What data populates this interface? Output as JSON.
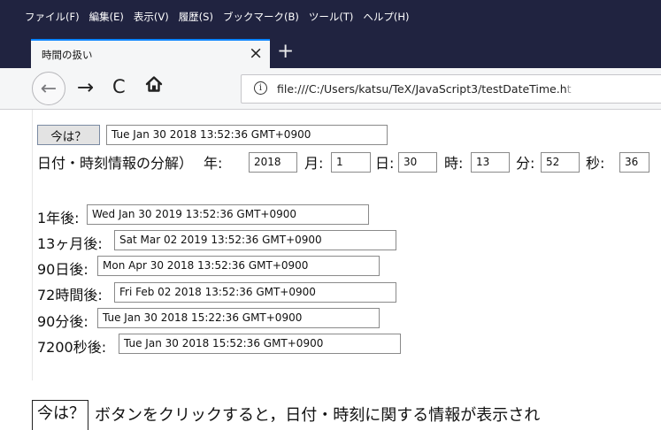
{
  "menu": [
    "ファイル(F)",
    "編集(E)",
    "表示(V)",
    "履歴(S)",
    "ブックマーク(B)",
    "ツール(T)",
    "ヘルプ(H)"
  ],
  "tab": {
    "title": "時間の扱い",
    "close": "×"
  },
  "newtab": "+",
  "nav": {
    "back": "←",
    "forward": "→",
    "reload": "C"
  },
  "url": {
    "text": "file:///C:/Users/katsu/TeX/JavaScript3/testDateTime.h",
    "faded": "t"
  },
  "now": {
    "button": "今は？",
    "value": "Tue Jan 30 2018 13:52:36 GMT+0900"
  },
  "decompose": {
    "label": "日付・時刻情報の分解）",
    "year_label": "年:",
    "year": "2018",
    "month_label": "月:",
    "month": "1",
    "day_label": "日:",
    "day": "30",
    "hour_label": "時:",
    "hour": "13",
    "minute_label": "分:",
    "minute": "52",
    "second_label": "秒:",
    "second": "36"
  },
  "offsets": [
    {
      "label": "1年後:",
      "value": "Wed Jan 30 2019 13:52:36 GMT+0900"
    },
    {
      "label": "13ヶ月後:",
      "value": "Sat Mar 02 2019 13:52:36 GMT+0900"
    },
    {
      "label": "90日後:",
      "value": "Mon Apr 30 2018 13:52:36 GMT+0900"
    },
    {
      "label": "72時間後:",
      "value": "Fri Feb 02 2018 13:52:36 GMT+0900"
    },
    {
      "label": "90分後:",
      "value": "Tue Jan 30 2018 15:22:36 GMT+0900"
    },
    {
      "label": "7200秒後:",
      "value": "Tue Jan 30 2018 15:52:36 GMT+0900"
    }
  ],
  "caption": {
    "button": "今は？",
    "text": "ボタンをクリックすると，日付・時刻に関する情報が表示され"
  }
}
